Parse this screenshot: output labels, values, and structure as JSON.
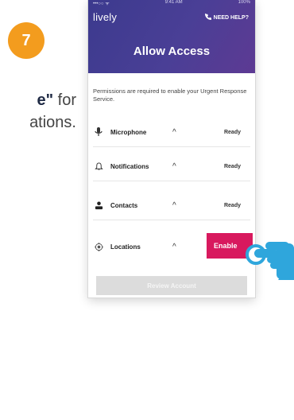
{
  "step": {
    "number": "7"
  },
  "instruction": {
    "line1_quote": "e\"",
    "line1_rest": " for",
    "line2": "ations."
  },
  "phone": {
    "statusbar": {
      "left": "•••○○ ᯤ",
      "time": "9:41 AM",
      "battery": "100%"
    },
    "brand": "lively",
    "help_label": "NEED HELP?",
    "title": "Allow Access",
    "description": "Permissions are required to enable your Urgent Response Service.",
    "permissions": [
      {
        "label": "Microphone",
        "status": "Ready",
        "icon": "microphone-icon"
      },
      {
        "label": "Notifications",
        "status": "Ready",
        "icon": "bell-icon"
      },
      {
        "label": "Contacts",
        "status": "Ready",
        "icon": "person-icon"
      },
      {
        "label": "Locations",
        "status": "",
        "icon": "location-icon"
      }
    ],
    "enable_label": "Enable",
    "review_label": "Review Account"
  },
  "colors": {
    "badge": "#f39c1e",
    "hero_start": "#3c3a8e",
    "hero_end": "#5d3a93",
    "enable": "#d8195e",
    "hand": "#2fa6dc"
  }
}
